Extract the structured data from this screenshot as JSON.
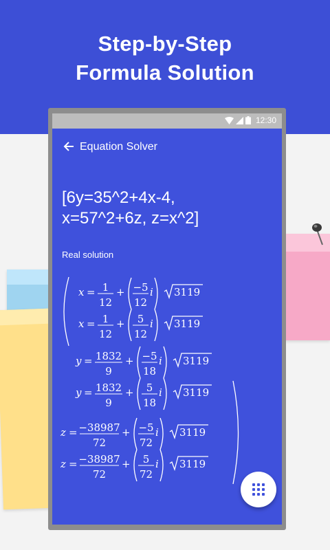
{
  "banner": {
    "line1": "Step-by-Step",
    "line2": "Formula Solution",
    "color": "#3d4fd6"
  },
  "statusbar": {
    "time": "12:30",
    "icons": [
      "wifi-icon",
      "signal-icon",
      "battery-icon"
    ]
  },
  "appbar": {
    "title": "Equation Solver",
    "back_icon": "arrow-left-icon"
  },
  "equation": {
    "line1": "[6y=35^2+4x-4,",
    "line2": "x=57^2+6z, z=x^2]"
  },
  "solution": {
    "label": "Real solution",
    "rows": [
      {
        "var": "x",
        "a_num": "1",
        "a_den": "12",
        "b_num": "−5",
        "b_den": "12",
        "i": "i",
        "root": "3119"
      },
      {
        "var": "x",
        "a_num": "1",
        "a_den": "12",
        "b_num": "5",
        "b_den": "12",
        "i": "i",
        "root": "3119"
      },
      {
        "var": "y",
        "a_num": "1832",
        "a_den": "9",
        "b_num": "−5",
        "b_den": "18",
        "i": "i",
        "root": "3119"
      },
      {
        "var": "y",
        "a_num": "1832",
        "a_den": "9",
        "b_num": "5",
        "b_den": "18",
        "i": "i",
        "root": "3119"
      },
      {
        "var": "z",
        "a_num": "−38987",
        "a_den": "72",
        "b_num": "−5",
        "b_den": "72",
        "i": "i",
        "root": "3119"
      },
      {
        "var": "z",
        "a_num": "−38987",
        "a_den": "72",
        "b_num": "5",
        "b_den": "72",
        "i": "i",
        "root": "3119"
      }
    ]
  },
  "fab": {
    "icon": "keypad-grid-icon"
  },
  "colors": {
    "accent": "#3f51dc",
    "status_bar": "#bdbdbd"
  }
}
